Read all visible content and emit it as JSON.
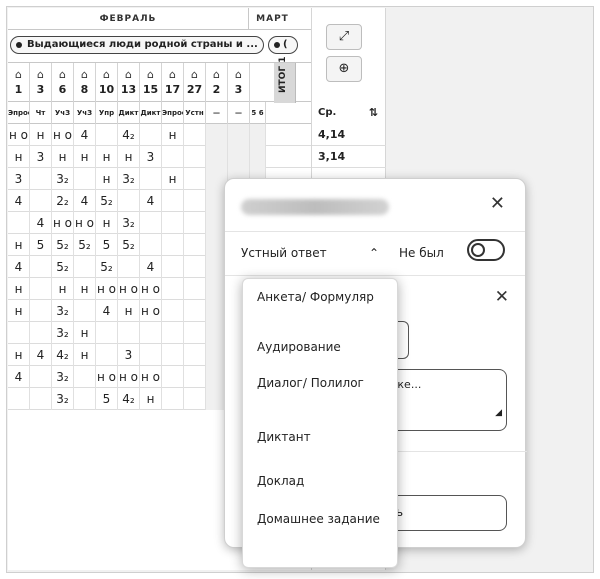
{
  "journal": {
    "months": [
      "ФЕВРАЛЬ",
      "МАРТ"
    ],
    "topics": [
      "Выдающиеся люди родной страны и ...",
      "("
    ],
    "house_glyph": "⌂",
    "days": [
      "1",
      "3",
      "6",
      "8",
      "10",
      "13",
      "15",
      "17",
      "27",
      "2",
      "3"
    ],
    "itog_label": "ИТОГ 1",
    "work_types": [
      "Эпрос",
      "Чт",
      "УчЗ",
      "УчЗ",
      "Упр",
      "Дикт",
      "Дикт",
      "Эпрос",
      "Устн",
      "—",
      "—",
      "5 6"
    ],
    "rows": [
      [
        "н о",
        "н",
        "н о",
        "4",
        "",
        "4₂",
        "",
        "н",
        "",
        "",
        "",
        ""
      ],
      [
        "н",
        "3",
        "н",
        "н",
        "н",
        "н",
        "3",
        "",
        "",
        "",
        "",
        ""
      ],
      [
        "3",
        "",
        "3₂",
        "",
        "н",
        "3₂",
        "",
        "н",
        "",
        "",
        "",
        ""
      ],
      [
        "4",
        "",
        "2₂",
        "4",
        "5₂",
        "",
        "4",
        "",
        "",
        "",
        "",
        ""
      ],
      [
        "",
        "4",
        "н о",
        "н о",
        "н",
        "3₂",
        "",
        "",
        "",
        "",
        "",
        ""
      ],
      [
        "н",
        "5",
        "5₂",
        "5₂",
        "5",
        "5₂",
        "",
        "",
        "",
        "",
        "",
        ""
      ],
      [
        "4",
        "",
        "5₂",
        "",
        "5₂",
        "",
        "4",
        "",
        "",
        "",
        "",
        ""
      ],
      [
        "н",
        "",
        "н",
        "н",
        "н о",
        "н о",
        "н о",
        "",
        "",
        "",
        "",
        ""
      ],
      [
        "н",
        "",
        "3₂",
        "",
        "4",
        "н",
        "н о",
        "",
        "",
        "",
        "",
        ""
      ],
      [
        "",
        "",
        "3₂",
        "н",
        "",
        "",
        "",
        "",
        "",
        "",
        "",
        ""
      ],
      [
        "н",
        "4",
        "4₂",
        "н",
        "",
        "3",
        "",
        "",
        "",
        "",
        "",
        ""
      ],
      [
        "4",
        "",
        "3₂",
        "",
        "н о",
        "н о",
        "н о",
        "",
        "",
        "",
        "",
        ""
      ],
      [
        "",
        "",
        "3₂",
        "",
        "5",
        "4₂",
        "н",
        "",
        "",
        "",
        "",
        ""
      ]
    ]
  },
  "side": {
    "expand_icon": "⤢",
    "zoom_icon": "⊕",
    "avg_label": "Ср.",
    "sort_icon": "⇅",
    "averages": [
      "4,14",
      "3,14"
    ]
  },
  "card": {
    "close_icon": "✕",
    "work_type": "Устный ответ",
    "chevron_icon": "⌃",
    "absent_label": "Не был",
    "inner_close_icon": "✕",
    "note_placeholder_visible": "тке...",
    "resize_icon": "◢",
    "button_visible": "ть"
  },
  "dropdown": {
    "options": [
      "Анкета/ Формуляр",
      "Аудирование",
      "Диалог/ Полилог",
      "Диктант",
      "Доклад",
      "Домашнее задание"
    ]
  }
}
